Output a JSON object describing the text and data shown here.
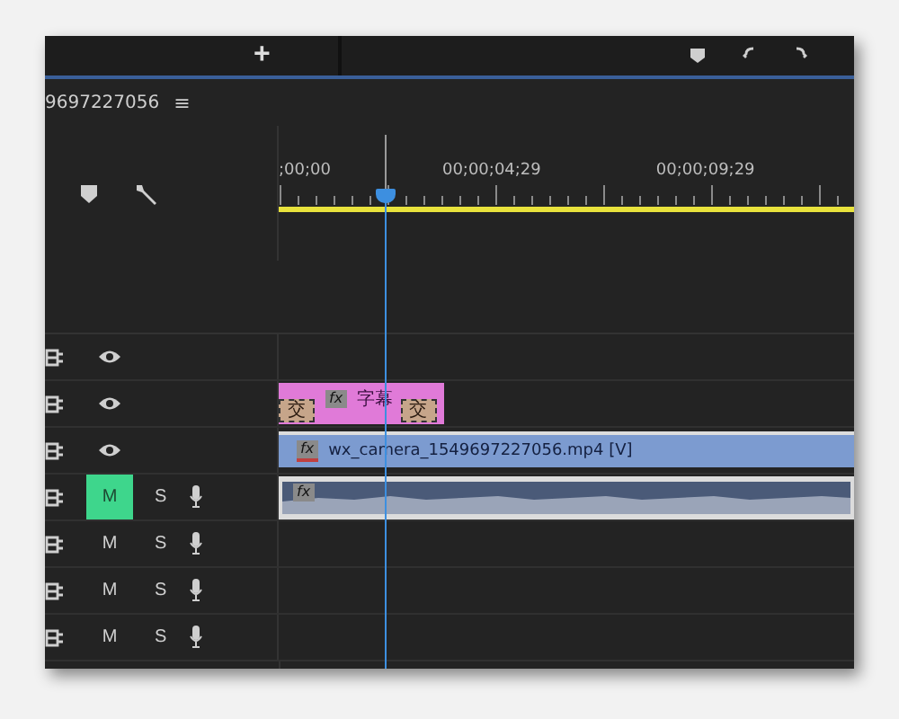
{
  "top_bar": {
    "add_button": "+"
  },
  "sequence": {
    "name": "9697227056",
    "menu": "≡"
  },
  "ruler": {
    "timecodes": [
      ";00;00",
      "00;00;04;29",
      "00;00;09;29"
    ]
  },
  "tracks": [
    {
      "kind": "video"
    },
    {
      "kind": "video",
      "clip": {
        "kind": "title",
        "badge": "fx",
        "label": "字幕",
        "transitions": [
          "交",
          "交"
        ]
      }
    },
    {
      "kind": "video",
      "clip": {
        "kind": "video",
        "badge": "fx",
        "label": "wx_camera_1549697227056.mp4 [V]"
      }
    },
    {
      "kind": "audio",
      "mute": "M",
      "muted": true,
      "solo": "S",
      "clip": {
        "kind": "audio",
        "badge": "fx"
      }
    },
    {
      "kind": "audio",
      "mute": "M",
      "muted": false,
      "solo": "S"
    },
    {
      "kind": "audio",
      "mute": "M",
      "muted": false,
      "solo": "S"
    },
    {
      "kind": "audio",
      "mute": "M",
      "muted": false,
      "solo": "S"
    }
  ]
}
